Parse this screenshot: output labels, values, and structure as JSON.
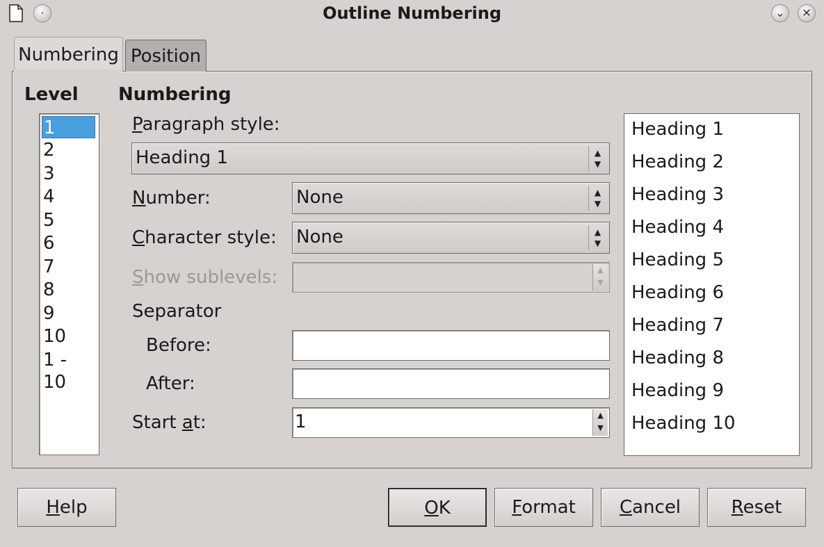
{
  "window": {
    "title": "Outline Numbering"
  },
  "tabs": [
    {
      "label": "Numbering",
      "active": true
    },
    {
      "label": "Position",
      "active": false
    }
  ],
  "level": {
    "heading": "Level",
    "items": [
      "1",
      "2",
      "3",
      "4",
      "5",
      "6",
      "7",
      "8",
      "9",
      "10",
      "1 - 10"
    ],
    "selected": "1"
  },
  "numbering": {
    "heading": "Numbering",
    "paragraph_style_label_mn": "P",
    "paragraph_style_label_rest": "aragraph style:",
    "paragraph_style_value": "Heading 1",
    "number_label_mn": "N",
    "number_label_rest": "umber:",
    "number_value": "None",
    "character_style_label_mn": "C",
    "character_style_label_rest": "haracter style:",
    "character_style_value": "None",
    "show_sublevels_label_mn": "S",
    "show_sublevels_label_rest": "how sublevels:",
    "show_sublevels_value": "",
    "separator_label": "Separator",
    "before_label": "Before:",
    "before_value": "",
    "after_label": "After:",
    "after_value": "",
    "start_at_label_pre": "Start ",
    "start_at_label_mn": "a",
    "start_at_label_post": "t:",
    "start_at_value": "1"
  },
  "preview": {
    "items": [
      "Heading 1",
      "Heading 2",
      "Heading 3",
      "Heading 4",
      "Heading 5",
      "Heading 6",
      "Heading 7",
      "Heading 8",
      "Heading 9",
      "Heading 10"
    ]
  },
  "buttons": {
    "help_mn": "H",
    "help_rest": "elp",
    "ok_mn": "O",
    "ok_rest": "K",
    "format_mn": "F",
    "format_rest": "ormat",
    "cancel_mn": "C",
    "cancel_rest": "ancel",
    "reset_mn": "R",
    "reset_rest": "eset"
  }
}
